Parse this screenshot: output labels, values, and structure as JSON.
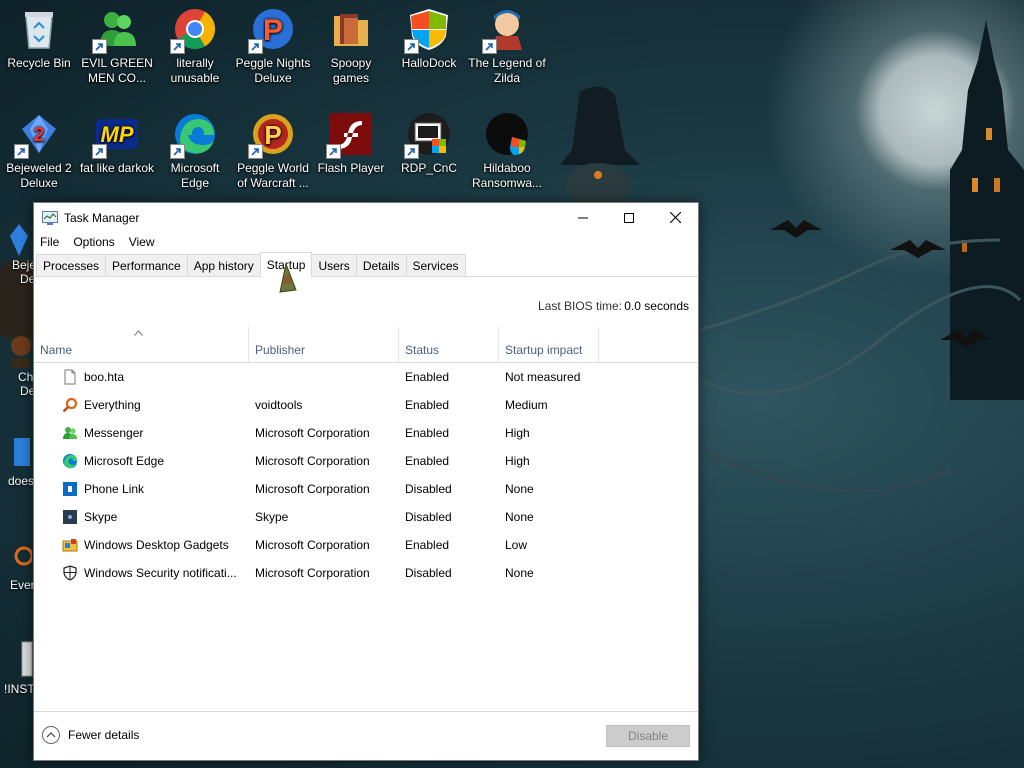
{
  "desktop": {
    "icons": [
      {
        "label": "Recycle Bin",
        "icon": "recycle-bin-icon"
      },
      {
        "label": "EVIL GREEN MEN CO...",
        "icon": "messenger-people-icon"
      },
      {
        "label": "literally unusable",
        "icon": "chrome-icon"
      },
      {
        "label": "Peggle Nights Deluxe",
        "icon": "peggle-icon"
      },
      {
        "label": "Spoopy games",
        "icon": "folder-icon"
      },
      {
        "label": "HalloDock",
        "icon": "windows-shield-icon"
      },
      {
        "label": "The Legend of Zilda",
        "icon": "character-icon"
      },
      {
        "label": "Bejeweled 2 Deluxe",
        "icon": "bejeweled-icon"
      },
      {
        "label": "fat like darkok",
        "icon": "mp-logo-icon"
      },
      {
        "label": "Microsoft Edge",
        "icon": "edge-icon"
      },
      {
        "label": "Peggle World of Warcraft ...",
        "icon": "peggle-icon"
      },
      {
        "label": "Flash Player",
        "icon": "flash-icon"
      },
      {
        "label": "RDP_CnC",
        "icon": "rdp-icon"
      },
      {
        "label": "Hildaboo Ransomwa...",
        "icon": "ransomware-icon"
      }
    ],
    "left_partial": [
      "Beje",
      "De",
      "Ch",
      "De",
      "does",
      "Ever",
      "!INST"
    ]
  },
  "window": {
    "title": "Task Manager",
    "menu": [
      "File",
      "Options",
      "View"
    ],
    "tabs": [
      "Processes",
      "Performance",
      "App history",
      "Startup",
      "Users",
      "Details",
      "Services"
    ],
    "active_tab": "Startup",
    "bios_label": "Last BIOS time:",
    "bios_value": "0.0 seconds",
    "columns": [
      "Name",
      "Publisher",
      "Status",
      "Startup impact"
    ],
    "rows": [
      {
        "name": "boo.hta",
        "publisher": "",
        "status": "Enabled",
        "impact": "Not measured",
        "icon": "file-icon"
      },
      {
        "name": "Everything",
        "publisher": "voidtools",
        "status": "Enabled",
        "impact": "Medium",
        "icon": "magnifier-icon"
      },
      {
        "name": "Messenger",
        "publisher": "Microsoft Corporation",
        "status": "Enabled",
        "impact": "High",
        "icon": "messenger-icon"
      },
      {
        "name": "Microsoft Edge",
        "publisher": "Microsoft Corporation",
        "status": "Enabled",
        "impact": "High",
        "icon": "edge-icon"
      },
      {
        "name": "Phone Link",
        "publisher": "Microsoft Corporation",
        "status": "Disabled",
        "impact": "None",
        "icon": "phone-link-icon"
      },
      {
        "name": "Skype",
        "publisher": "Skype",
        "status": "Disabled",
        "impact": "None",
        "icon": "skype-icon"
      },
      {
        "name": "Windows Desktop Gadgets",
        "publisher": "Microsoft Corporation",
        "status": "Enabled",
        "impact": "Low",
        "icon": "gadgets-icon"
      },
      {
        "name": "Windows Security notificati...",
        "publisher": "Microsoft Corporation",
        "status": "Disabled",
        "impact": "None",
        "icon": "shield-icon"
      }
    ],
    "fewer_details": "Fewer details",
    "disable_button": "Disable"
  }
}
